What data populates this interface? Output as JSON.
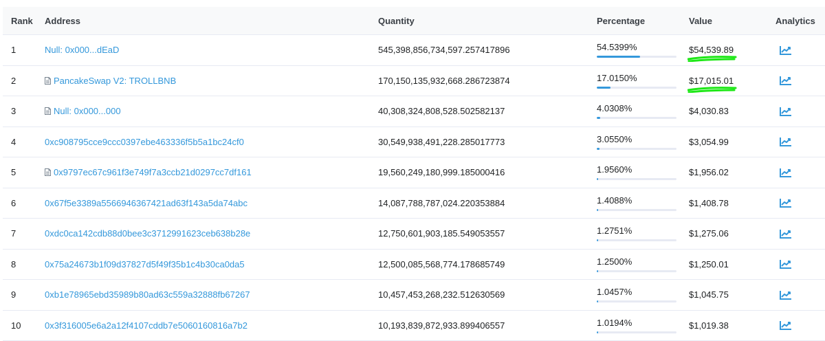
{
  "colors": {
    "link": "#3498db",
    "progress_track": "#e7eaf3",
    "progress_fill": "#3498db",
    "highlight": "#1ee817",
    "header_bg": "#f8f9fa"
  },
  "table": {
    "headers": {
      "rank": "Rank",
      "address": "Address",
      "quantity": "Quantity",
      "percentage": "Percentage",
      "value": "Value",
      "analytics": "Analytics"
    },
    "rows": [
      {
        "rank": "1",
        "address": "Null: 0x000...dEaD",
        "contract": false,
        "quantity": "545,398,856,734,597.257417896",
        "percentage": "54.5399%",
        "pct_value": 54.5399,
        "value": "$54,539.89",
        "highlighted": true,
        "analytics_icon": "chart-line-icon"
      },
      {
        "rank": "2",
        "address": "PancakeSwap V2: TROLLBNB",
        "contract": true,
        "quantity": "170,150,135,932,668.286723874",
        "percentage": "17.0150%",
        "pct_value": 17.015,
        "value": "$17,015.01",
        "highlighted": true,
        "analytics_icon": "chart-line-icon"
      },
      {
        "rank": "3",
        "address": "Null: 0x000...000",
        "contract": true,
        "quantity": "40,308,324,808,528.502582137",
        "percentage": "4.0308%",
        "pct_value": 4.0308,
        "value": "$4,030.83",
        "highlighted": false,
        "analytics_icon": "chart-line-icon"
      },
      {
        "rank": "4",
        "address": "0xc908795cce9ccc0397ebe463336f5b5a1bc24cf0",
        "contract": false,
        "quantity": "30,549,938,491,228.285017773",
        "percentage": "3.0550%",
        "pct_value": 3.055,
        "value": "$3,054.99",
        "highlighted": false,
        "analytics_icon": "chart-line-icon"
      },
      {
        "rank": "5",
        "address": "0x9797ec67c961f3e749f7a3ccb21d0297cc7df161",
        "contract": true,
        "quantity": "19,560,249,180,999.185000416",
        "percentage": "1.9560%",
        "pct_value": 1.956,
        "value": "$1,956.02",
        "highlighted": false,
        "analytics_icon": "chart-line-icon"
      },
      {
        "rank": "6",
        "address": "0x67f5e3389a5566946367421ad63f143a5da74abc",
        "contract": false,
        "quantity": "14,087,788,787,024.220353884",
        "percentage": "1.4088%",
        "pct_value": 1.4088,
        "value": "$1,408.78",
        "highlighted": false,
        "analytics_icon": "chart-line-icon"
      },
      {
        "rank": "7",
        "address": "0xdc0ca142cdb88d0bee3c3712991623ceb638b28e",
        "contract": false,
        "quantity": "12,750,601,903,185.549053557",
        "percentage": "1.2751%",
        "pct_value": 1.2751,
        "value": "$1,275.06",
        "highlighted": false,
        "analytics_icon": "chart-line-icon"
      },
      {
        "rank": "8",
        "address": "0x75a24673b1f09d37827d5f49f35b1c4b30ca0da5",
        "contract": false,
        "quantity": "12,500,085,568,774.178685749",
        "percentage": "1.2500%",
        "pct_value": 1.25,
        "value": "$1,250.01",
        "highlighted": false,
        "analytics_icon": "chart-line-icon"
      },
      {
        "rank": "9",
        "address": "0xb1e78965ebd35989b80ad63c559a32888fb67267",
        "contract": false,
        "quantity": "10,457,453,268,232.512630569",
        "percentage": "1.0457%",
        "pct_value": 1.0457,
        "value": "$1,045.75",
        "highlighted": false,
        "analytics_icon": "chart-line-icon"
      },
      {
        "rank": "10",
        "address": "0x3f316005e6a2a12f4107cddb7e5060160816a7b2",
        "contract": false,
        "quantity": "10,193,839,872,933.899406557",
        "percentage": "1.0194%",
        "pct_value": 1.0194,
        "value": "$1,019.38",
        "highlighted": false,
        "analytics_icon": "chart-line-icon"
      }
    ]
  }
}
